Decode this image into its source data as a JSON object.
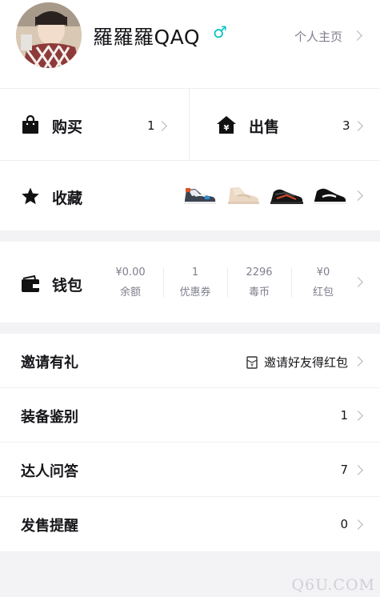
{
  "profile": {
    "username": "羅羅羅QAQ",
    "gender_symbol": "♂",
    "homepage_label": "个人主页"
  },
  "orders": {
    "buy": {
      "label": "购买",
      "count": "1"
    },
    "sell": {
      "label": "出售",
      "count": "3"
    }
  },
  "favorites": {
    "label": "收藏",
    "thumbnails": [
      "sneaker-1",
      "sneaker-2",
      "sneaker-3",
      "sneaker-4"
    ]
  },
  "wallet": {
    "label": "钱包",
    "stats": [
      {
        "value": "¥0.00",
        "label": "余额"
      },
      {
        "value": "1",
        "label": "优惠券"
      },
      {
        "value": "2296",
        "label": "毒币"
      },
      {
        "value": "¥0",
        "label": "红包"
      }
    ]
  },
  "menu": [
    {
      "label": "邀请有礼",
      "right": "邀请好友得红包",
      "icon": "red-envelope-icon"
    },
    {
      "label": "装备鉴别",
      "right": "1"
    },
    {
      "label": "达人问答",
      "right": "7"
    },
    {
      "label": "发售提醒",
      "right": "0"
    }
  ],
  "watermark": "Q6U.COM",
  "colors": {
    "accent": "#01c2c3",
    "text": "#16161a",
    "muted": "#7f7f8e",
    "background": "#f3f3f6"
  }
}
